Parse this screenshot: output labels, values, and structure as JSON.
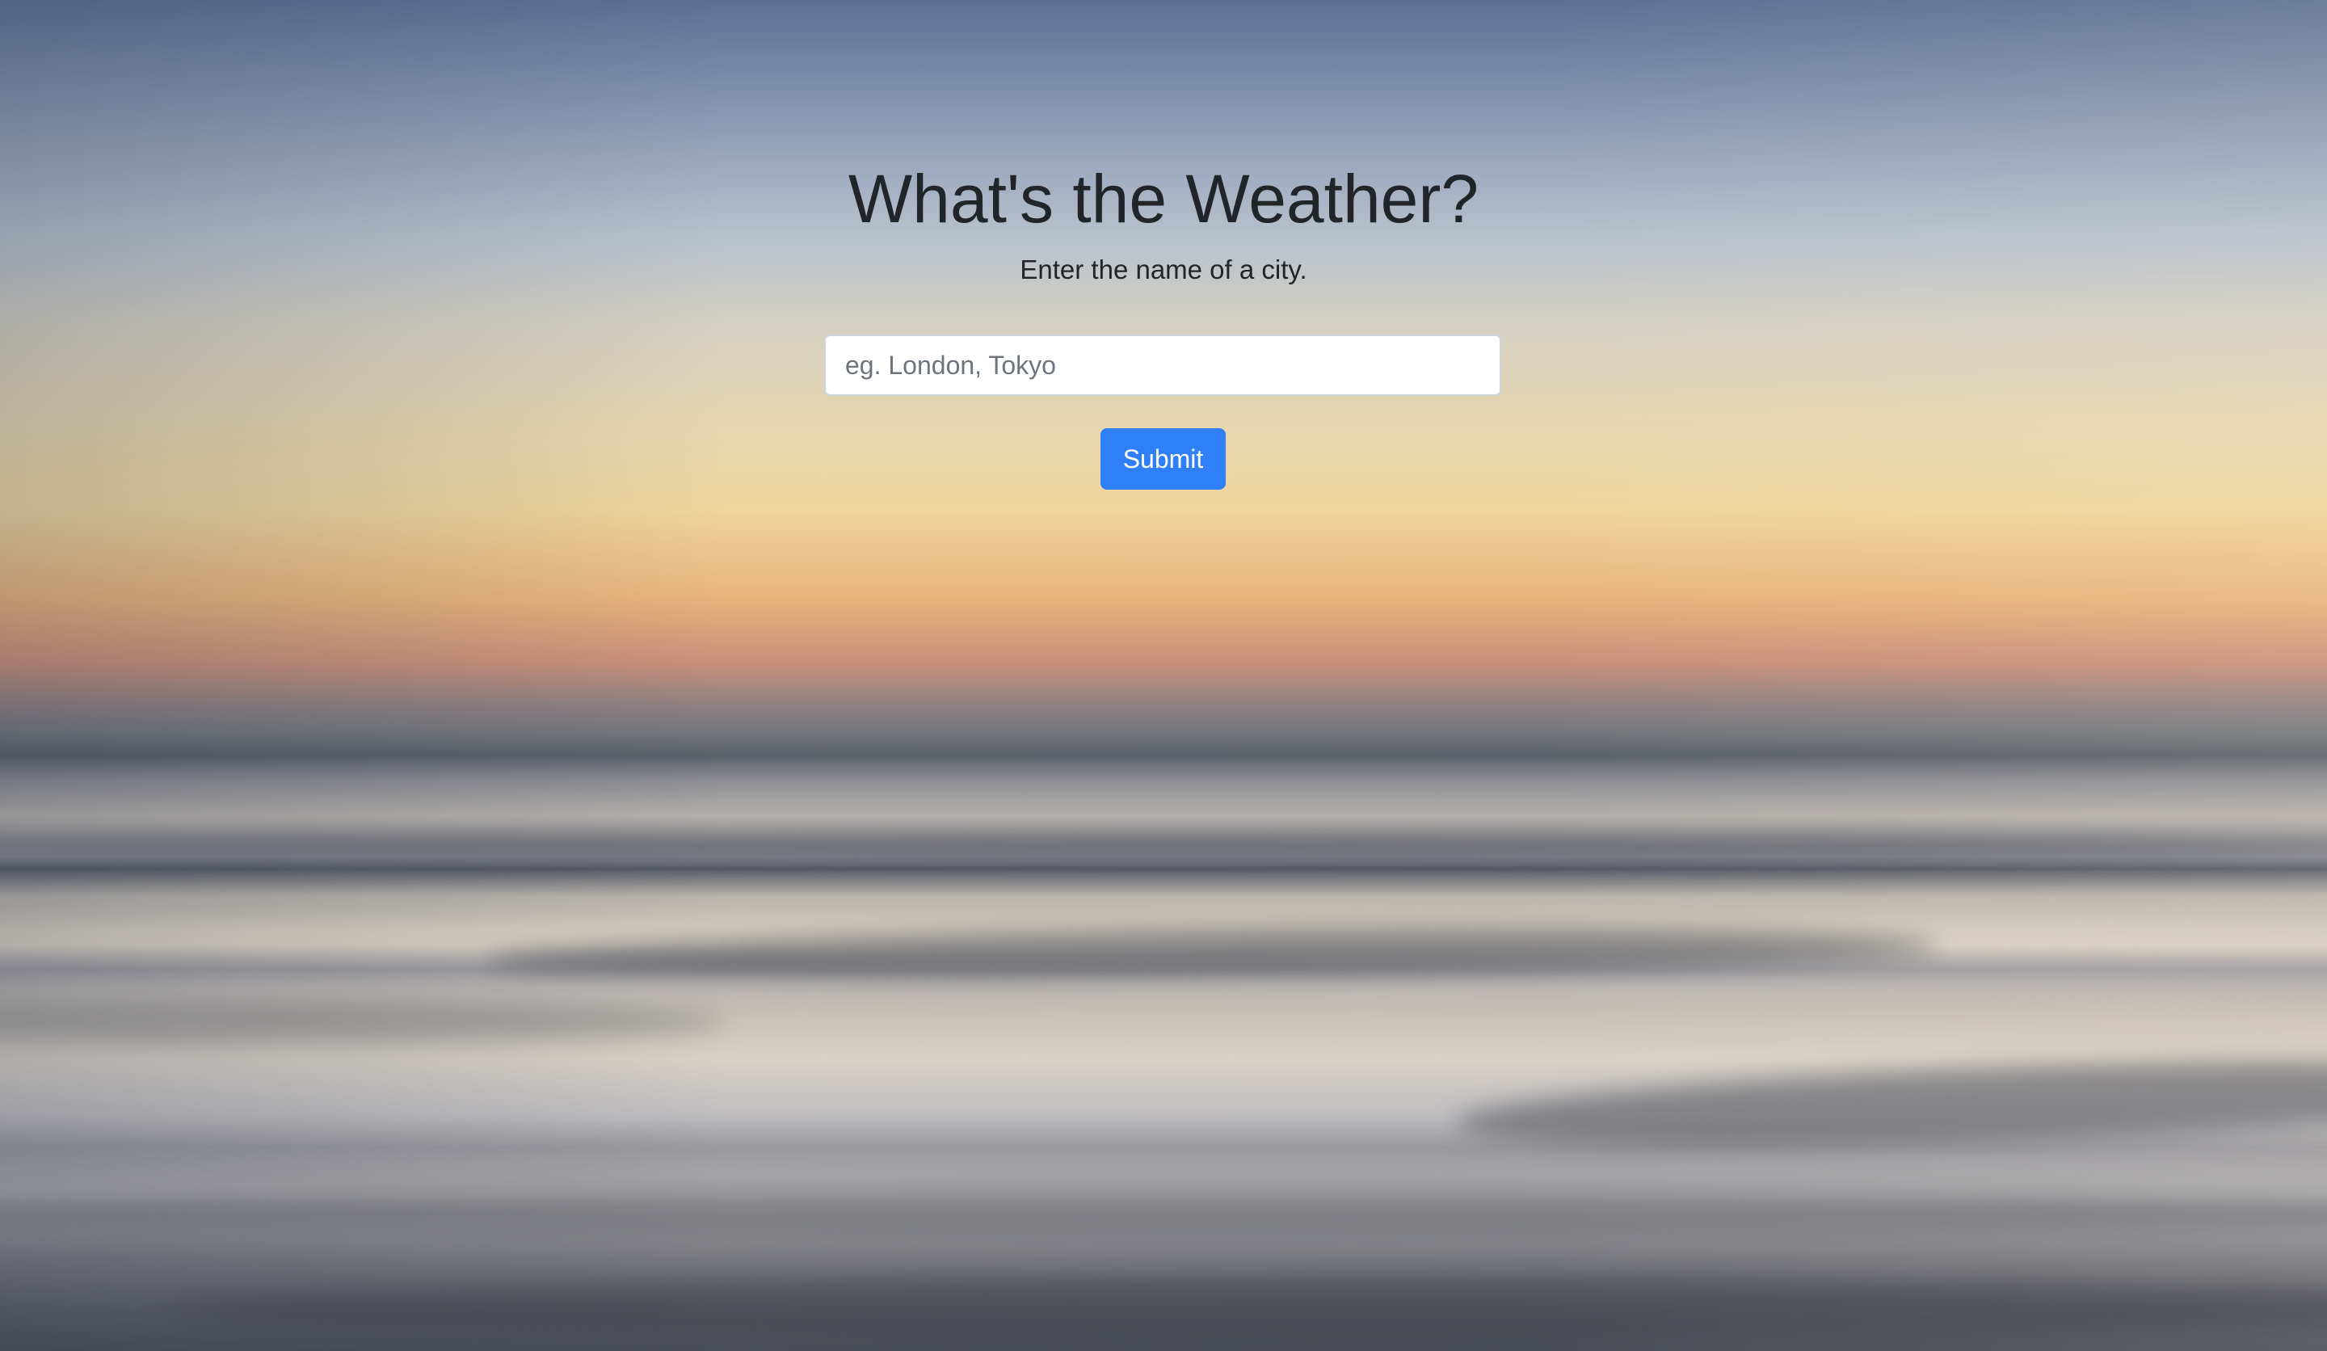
{
  "page": {
    "title": "What's the Weather?",
    "subtitle": "Enter the name of a city."
  },
  "form": {
    "city_input": {
      "value": "",
      "placeholder": "eg. London, Tokyo"
    },
    "submit_label": "Submit"
  },
  "colors": {
    "text": "#212529",
    "button_bg": "#2f7ff7",
    "button_text": "#ffffff",
    "input_border": "#ced4da",
    "placeholder": "#6c757d"
  }
}
